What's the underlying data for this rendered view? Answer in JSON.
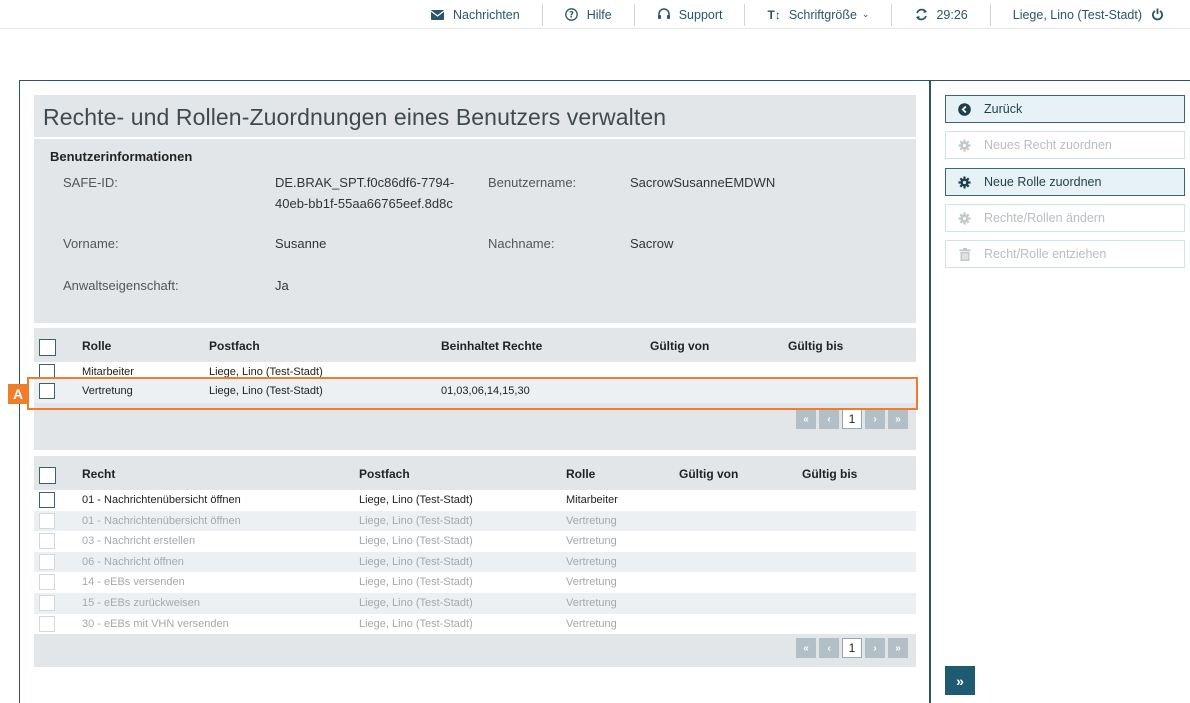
{
  "topbar": {
    "messages": "Nachrichten",
    "help": "Hilfe",
    "support": "Support",
    "font_size": "Schriftgröße",
    "session_timer": "29:26",
    "user": "Liege, Lino (Test-Stadt)"
  },
  "page": {
    "title": "Rechte- und Rollen-Zuordnungen eines Benutzers verwalten"
  },
  "user_info": {
    "heading": "Benutzerinformationen",
    "safe_id_label": "SAFE-ID:",
    "safe_id_line1": "DE.BRAK_SPT.f0c86df6-7794-",
    "safe_id_line2": "40eb-bb1f-55aa66765eef.8d8c",
    "username_label": "Benutzername:",
    "username_value": "SacrowSusanneEMDWN",
    "firstname_label": "Vorname:",
    "firstname_value": "Susanne",
    "lastname_label": "Nachname:",
    "lastname_value": "Sacrow",
    "lawyer_label": "Anwaltseigenschaft:",
    "lawyer_value": "Ja"
  },
  "roles_table": {
    "headers": [
      "Rolle",
      "Postfach",
      "Beinhaltet Rechte",
      "Gültig von",
      "Gültig bis"
    ],
    "rows": [
      {
        "role": "Mitarbeiter",
        "mailbox": "Liege, Lino (Test-Stadt)",
        "rights": "",
        "from": "",
        "to": ""
      },
      {
        "role": "Vertretung",
        "mailbox": "Liege, Lino (Test-Stadt)",
        "rights": "01,03,06,14,15,30",
        "from": "",
        "to": ""
      }
    ],
    "page": "1"
  },
  "rights_table": {
    "headers": [
      "Recht",
      "Postfach",
      "Rolle",
      "Gültig von",
      "Gültig bis"
    ],
    "rows": [
      {
        "right": "01 - Nachrichtenübersicht öffnen",
        "mailbox": "Liege, Lino (Test-Stadt)",
        "role": "Mitarbeiter"
      },
      {
        "right": "01 - Nachrichtenübersicht öffnen",
        "mailbox": "Liege, Lino (Test-Stadt)",
        "role": "Vertretung"
      },
      {
        "right": "03 - Nachricht erstellen",
        "mailbox": "Liege, Lino (Test-Stadt)",
        "role": "Vertretung"
      },
      {
        "right": "06 - Nachricht öffnen",
        "mailbox": "Liege, Lino (Test-Stadt)",
        "role": "Vertretung"
      },
      {
        "right": "14 - eEBs versenden",
        "mailbox": "Liege, Lino (Test-Stadt)",
        "role": "Vertretung"
      },
      {
        "right": "15 - eEBs zurückweisen",
        "mailbox": "Liege, Lino (Test-Stadt)",
        "role": "Vertretung"
      },
      {
        "right": "30 - eEBs mit VHN versenden",
        "mailbox": "Liege, Lino (Test-Stadt)",
        "role": "Vertretung"
      }
    ],
    "page": "1"
  },
  "pager": {
    "first": "«",
    "prev": "‹",
    "next": "›",
    "last": "»"
  },
  "actions": {
    "back": "Zurück",
    "new_right": "Neues Recht zuordnen",
    "new_role": "Neue Rolle zuordnen",
    "edit": "Rechte/Rollen ändern",
    "revoke": "Recht/Rolle entziehen",
    "expand": "»"
  },
  "annotation": {
    "label": "A",
    "color": "#ef7d2a"
  }
}
